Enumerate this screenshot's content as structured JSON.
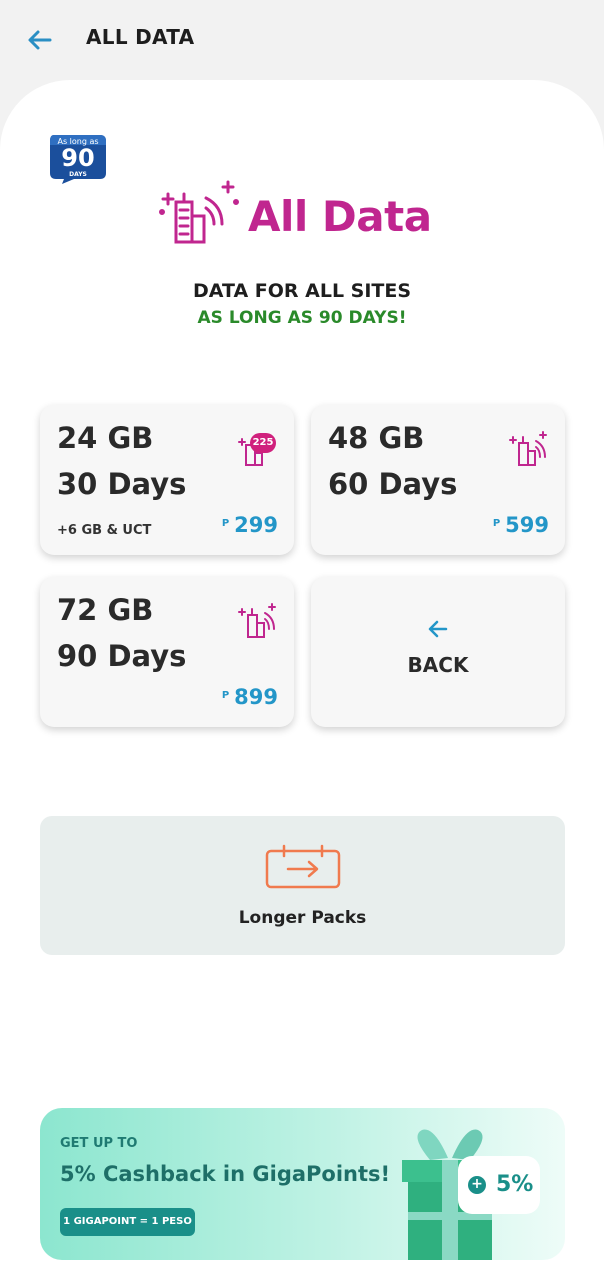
{
  "header": {
    "title": "ALL DATA"
  },
  "badge": {
    "top": "As long as",
    "number": "90",
    "bottom": "DAYS"
  },
  "brand": {
    "name": "All Data"
  },
  "intro": {
    "headline": "DATA FOR ALL SITES",
    "subline": "AS LONG AS 90 DAYS!"
  },
  "currency_symbol": "P",
  "packs": [
    {
      "data": "24 GB",
      "validity": "30 Days",
      "extra": "+6 GB & UCT",
      "price": "299",
      "badge": "225"
    },
    {
      "data": "48 GB",
      "validity": "60 Days",
      "extra": "",
      "price": "599"
    },
    {
      "data": "72 GB",
      "validity": "90 Days",
      "extra": "",
      "price": "899"
    }
  ],
  "back_card": {
    "label": "BACK"
  },
  "longer_packs": {
    "label": "Longer Packs"
  },
  "promo": {
    "kicker": "GET UP TO",
    "title": "5% Cashback in GigaPoints!",
    "note": "1 GIGAPOINT = 1 PESO",
    "badge_plus": "+",
    "badge_value": "5%"
  },
  "colors": {
    "accent_blue": "#2396c8",
    "brand_magenta": "#c0268f",
    "promo_teal": "#1a8f89",
    "success_green": "#2a8a2a"
  }
}
